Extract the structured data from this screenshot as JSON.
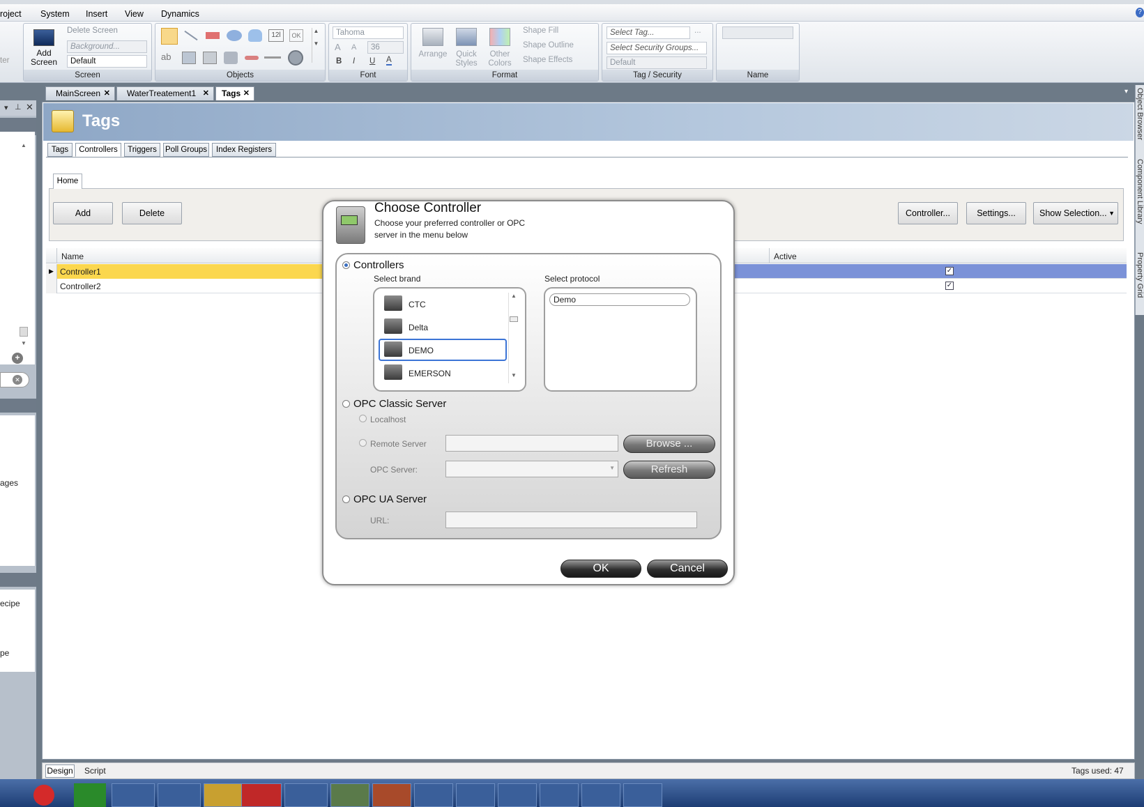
{
  "menu": {
    "items": [
      "roject",
      "System",
      "Insert",
      "View",
      "Dynamics"
    ]
  },
  "ribbon": {
    "screen_group": {
      "label": "Screen",
      "add_screen": "Add Screen",
      "delete_screen": "Delete Screen",
      "background": "Background...",
      "default": "Default",
      "left_text": "ter"
    },
    "objects_group": {
      "label": "Objects"
    },
    "font_group": {
      "label": "Font",
      "font": "Tahoma",
      "size": "36"
    },
    "format_group": {
      "label": "Format",
      "arrange": "Arrange",
      "quick_styles": "Quick Styles",
      "other_colors": "Other Colors",
      "shape_fill": "Shape Fill",
      "shape_outline": "Shape Outline",
      "shape_effects": "Shape Effects"
    },
    "tag_group": {
      "label": "Tag / Security",
      "select_tag": "Select Tag...",
      "select_security": "Select Security Groups...",
      "default": "Default"
    },
    "name_group": {
      "label": "Name"
    }
  },
  "doc_tabs": [
    {
      "label": "MainScreen"
    },
    {
      "label": "WaterTreatement1"
    },
    {
      "label": "Tags"
    }
  ],
  "page": {
    "title": "Tags"
  },
  "sub_tabs": [
    "Tags",
    "Controllers",
    "Triggers",
    "Poll Groups",
    "Index Registers"
  ],
  "home_tab": "Home",
  "toolbar": {
    "add": "Add",
    "delete": "Delete",
    "controller": "Controller...",
    "settings": "Settings...",
    "show_selection": "Show Selection..."
  },
  "grid": {
    "col_name": "Name",
    "col_active": "Active",
    "rows": [
      {
        "name": "Controller1",
        "active": true
      },
      {
        "name": "Controller2",
        "active": true
      }
    ]
  },
  "left_pane": {
    "text1": "ages",
    "text2": "ecipe",
    "text3": "pe"
  },
  "dialog": {
    "title": "Choose Controller",
    "subtitle1": "Choose your preferred controller or OPC",
    "subtitle2": "server in the menu below",
    "controllers": "Controllers",
    "select_brand": "Select brand",
    "select_protocol": "Select protocol",
    "brands": [
      "CTC",
      "Delta",
      "DEMO",
      "EMERSON"
    ],
    "selected_brand": "DEMO",
    "protocol": "Demo",
    "opc_classic": "OPC Classic Server",
    "localhost": "Localhost",
    "remote_server": "Remote Server",
    "browse": "Browse ...",
    "opc_server": "OPC Server:",
    "refresh": "Refresh",
    "opc_ua": "OPC UA Server",
    "url": "URL:",
    "ok": "OK",
    "cancel": "Cancel"
  },
  "bottom": {
    "design": "Design",
    "script": "Script",
    "tags_used": "Tags used: 47"
  },
  "side_panels": {
    "object_browser": "Object Browser",
    "component_library": "Component Library",
    "property_grid": "Property Grid"
  }
}
